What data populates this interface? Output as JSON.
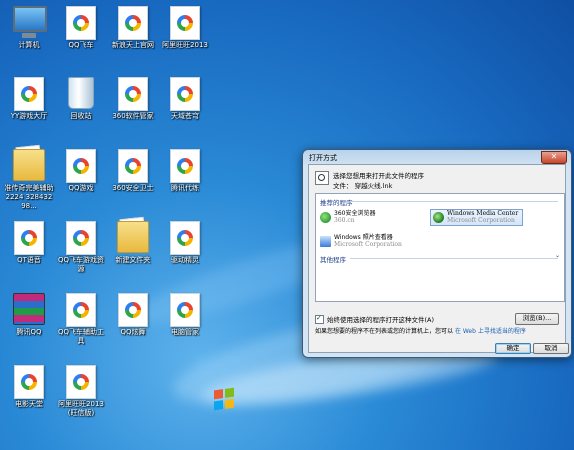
{
  "desktop": {
    "icons": [
      {
        "label": "计算机",
        "type": "computer"
      },
      {
        "label": "QQ飞车",
        "type": "doc"
      },
      {
        "label": "新浪天上官网",
        "type": "doc"
      },
      {
        "label": "阿里旺旺2013",
        "type": "doc"
      },
      {
        "label": "YY游戏大厅",
        "type": "doc"
      },
      {
        "label": "回收站",
        "type": "recycle"
      },
      {
        "label": "360软件管家",
        "type": "doc"
      },
      {
        "label": "天域苍穹",
        "type": "doc"
      },
      {
        "label": "准传奇完美辅助2224 32843298...",
        "type": "folder"
      },
      {
        "label": "QQ游戏",
        "type": "doc"
      },
      {
        "label": "360安全卫士",
        "type": "doc"
      },
      {
        "label": "腾讯代练",
        "type": "doc"
      },
      {
        "label": "QT语音",
        "type": "doc"
      },
      {
        "label": "QQ飞车游戏资源",
        "type": "doc"
      },
      {
        "label": "新建文件夹",
        "type": "folder"
      },
      {
        "label": "驱动精灵",
        "type": "doc"
      },
      {
        "label": "腾讯QQ",
        "type": "rar"
      },
      {
        "label": "QQ飞车辅助工具",
        "type": "doc"
      },
      {
        "label": "QQ炫舞",
        "type": "doc"
      },
      {
        "label": "电脑管家",
        "type": "doc"
      },
      {
        "label": "电影天堂",
        "type": "doc"
      },
      {
        "label": "阿里旺旺2013 (旺信版)",
        "type": "doc"
      }
    ]
  },
  "dialog": {
    "title": "打开方式",
    "close_glyph": "✕",
    "prompt": "选择您想用来打开此文件的程序",
    "file_label": "文件：",
    "file_name": "穿越火线.lnk",
    "recommended_header": "推荐的程序",
    "programs": [
      {
        "name": "360安全浏览器",
        "sub": "360.cn",
        "icon": "360-browser-icon",
        "color": "#3aa844"
      },
      {
        "name": "Windows Media Center",
        "sub": "Microsoft Corporation",
        "icon": "media-center-icon",
        "color": "#2b8a2b"
      },
      {
        "name": "Windows 照片查看器",
        "sub": "Microsoft Corporation",
        "icon": "photo-viewer-icon",
        "color": "#3a7ad8"
      }
    ],
    "other_header": "其他程序",
    "other_chevron": "⌄",
    "always_use_label": "始终使用选择的程序打开这种文件(A)",
    "browse_label": "浏览(B)...",
    "info_text": "如果您想要的程序不在列表或您的计算机上，您可以",
    "info_link": "在 Web 上寻找适当的程序",
    "ok_label": "确定",
    "cancel_label": "取消"
  }
}
